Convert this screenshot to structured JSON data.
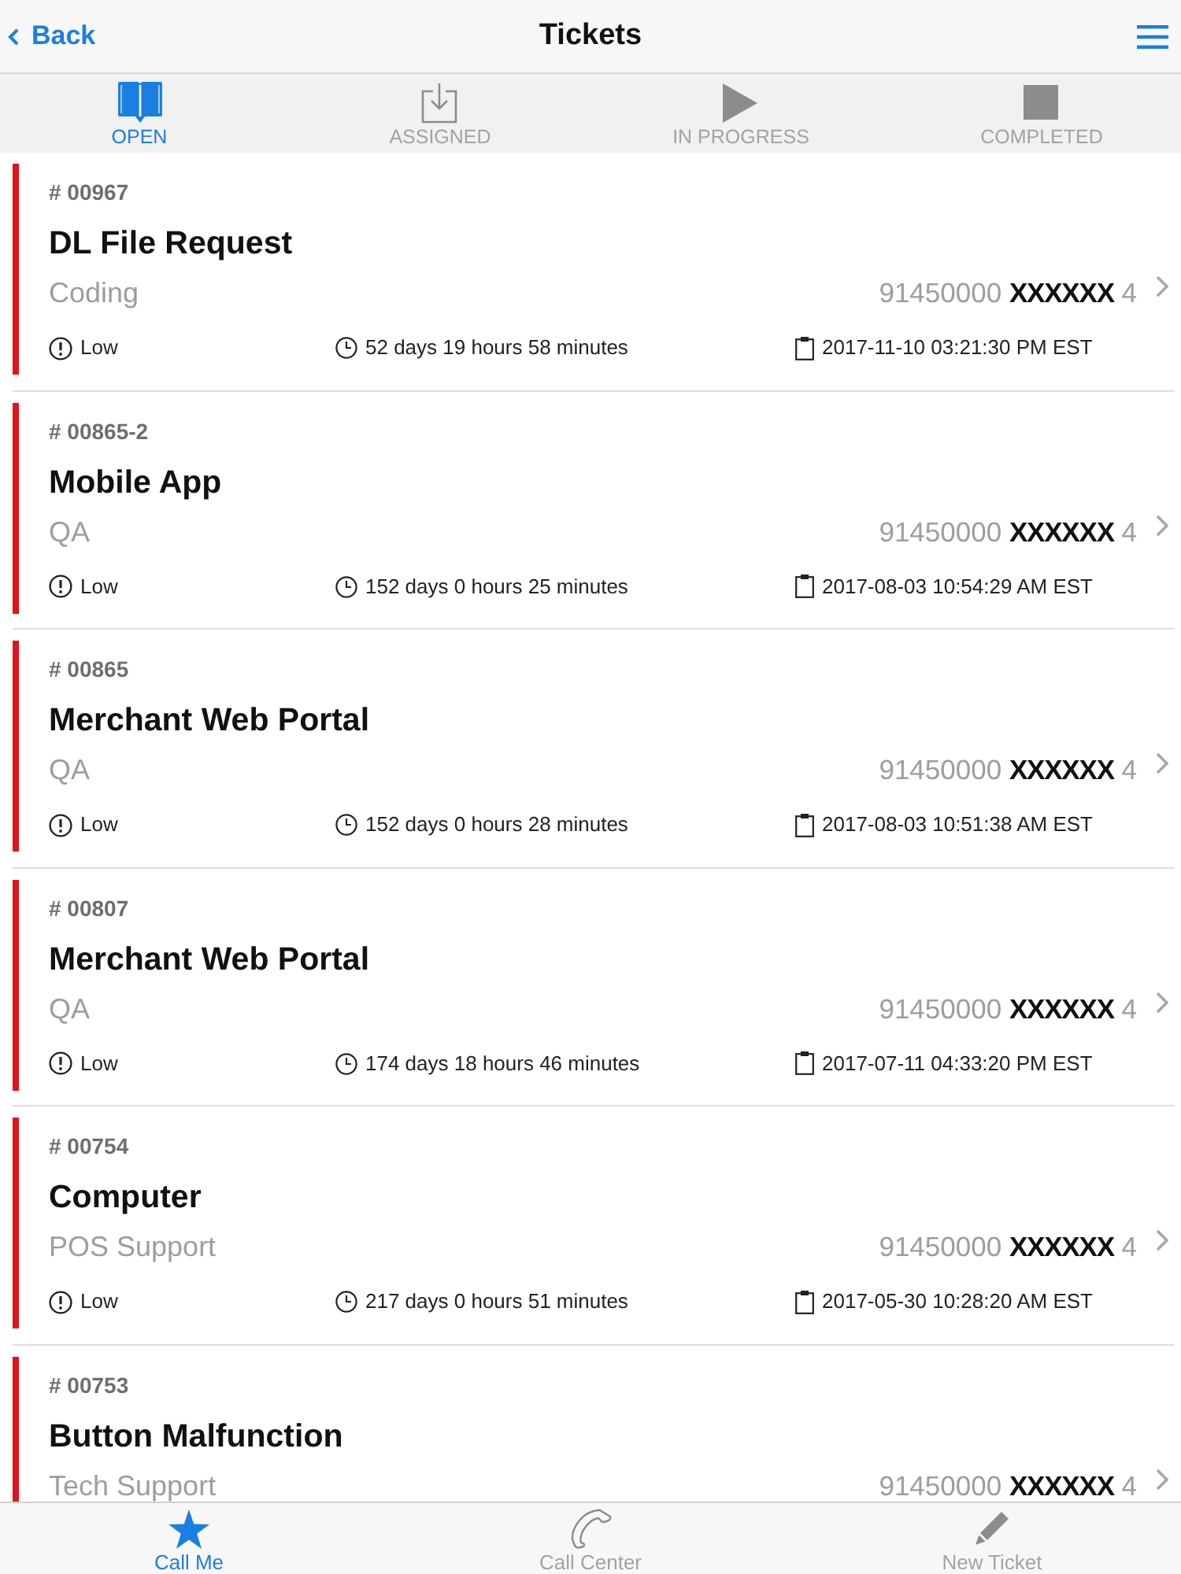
{
  "nav_bar": {
    "back": "Back",
    "title": "Tickets"
  },
  "tabs": [
    {
      "label": "OPEN",
      "selected": true
    },
    {
      "label": "ASSIGNED",
      "selected": false
    },
    {
      "label": "IN PROGRESS",
      "selected": false
    },
    {
      "label": "COMPLETED",
      "selected": false
    }
  ],
  "tickets": [
    {
      "number": "# 00967",
      "title": "DL File Request",
      "category": "Coding",
      "account": "91450000 **XXXXXX** 4",
      "priority": "Low",
      "age": "52 days 19 hours 58 minutes",
      "created": "2017-11-10 03:21:30 PM EST"
    },
    {
      "number": "# 00865-2",
      "title": "Mobile App",
      "category": "QA",
      "account": "91450000 **XXXXXX** 4",
      "priority": "Low",
      "age": "152 days 0 hours 25 minutes",
      "created": "2017-08-03 10:54:29 AM EST"
    },
    {
      "number": "# 00865",
      "title": "Merchant Web Portal",
      "category": "QA",
      "account": "91450000 **XXXXXX** 4",
      "priority": "Low",
      "age": "152 days 0 hours 28 minutes",
      "created": "2017-08-03 10:51:38 AM EST"
    },
    {
      "number": "# 00807",
      "title": "Merchant Web Portal",
      "category": "QA",
      "account": "91450000 **XXXXXX** 4",
      "priority": "Low",
      "age": "174 days 18 hours 46 minutes",
      "created": "2017-07-11 04:33:20 PM EST"
    },
    {
      "number": "# 00754",
      "title": "Computer",
      "category": "POS Support",
      "account": "91450000 **XXXXXX** 4",
      "priority": "Low",
      "age": "217 days 0 hours 51 minutes",
      "created": "2017-05-30 10:28:20 AM EST"
    },
    {
      "number": "# 00753",
      "title": "Button Malfunction",
      "category": "Tech Support",
      "account": "91450000 **XXXXXX** 4"
    }
  ],
  "bottom_bar": [
    {
      "label": "Call Me",
      "selected": true
    },
    {
      "label": "Call Center",
      "selected": false
    },
    {
      "label": "New Ticket",
      "selected": false
    }
  ]
}
